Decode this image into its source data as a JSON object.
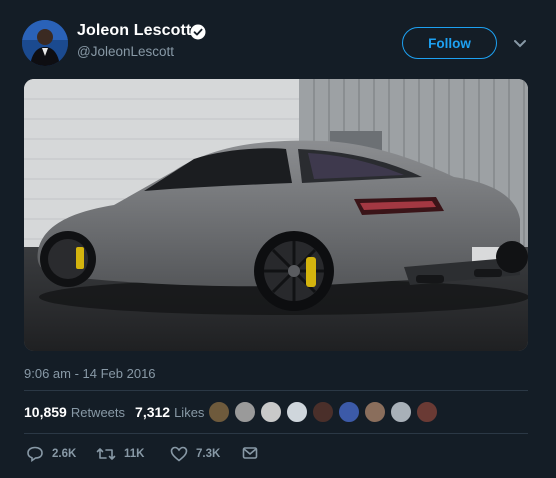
{
  "user": {
    "display_name": "Joleon Lescott",
    "handle": "@JoleonLescott",
    "follow_label": "Follow"
  },
  "tweet": {
    "timestamp": "9:06 am - 14 Feb 2016",
    "retweets_count": "10,859",
    "retweets_label": "Retweets",
    "likes_count": "7,312",
    "likes_label": "Likes"
  },
  "actions": {
    "replies": "2.6K",
    "retweets": "11K",
    "likes": "7.3K"
  },
  "colors": {
    "background": "#141d26",
    "accent": "#1da1f2",
    "muted": "#8899a6"
  }
}
